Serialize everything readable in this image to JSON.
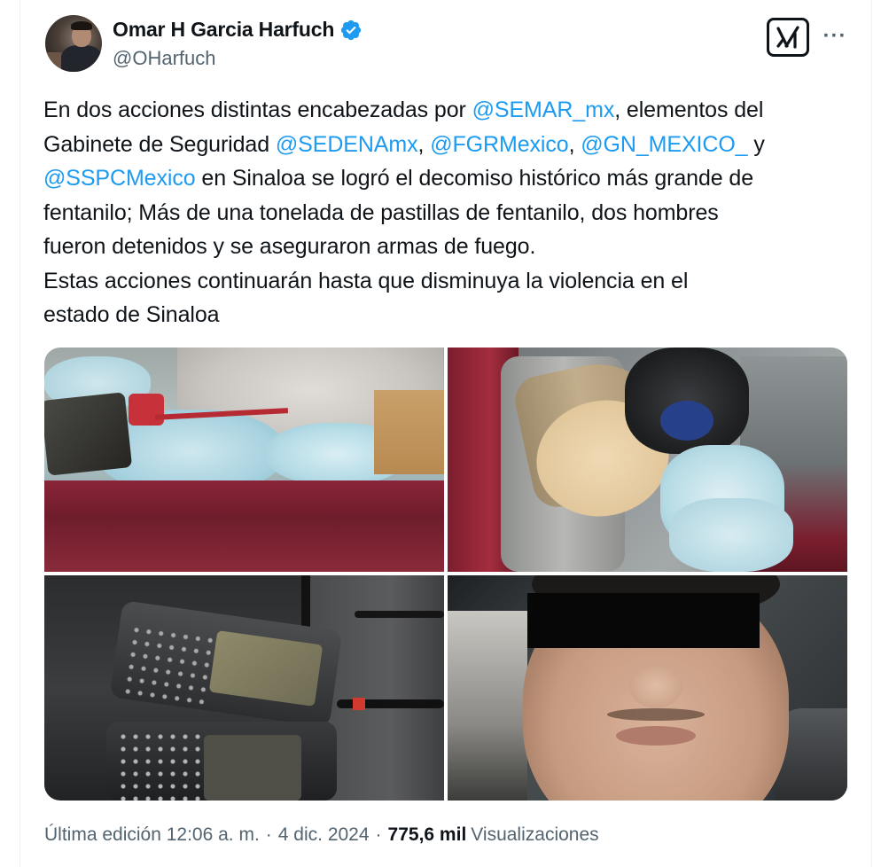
{
  "author": {
    "display_name": "Omar H Garcia Harfuch",
    "handle": "@OHarfuch",
    "verified": true
  },
  "actions": {
    "grok_icon": "grok-icon",
    "more_icon": "more-icon",
    "more_label": "···"
  },
  "tweet": {
    "lines": [
      [
        {
          "text": "En dos acciones distintas encabezadas por ",
          "mention": false
        },
        {
          "text": "@SEMAR_mx",
          "mention": true
        },
        {
          "text": ", elementos del",
          "mention": false
        }
      ],
      [
        {
          "text": "Gabinete de Seguridad ",
          "mention": false
        },
        {
          "text": "@SEDENAmx",
          "mention": true
        },
        {
          "text": ", ",
          "mention": false
        },
        {
          "text": "@FGRMexico",
          "mention": true
        },
        {
          "text": ", ",
          "mention": false
        },
        {
          "text": "@GN_MEXICO_",
          "mention": true
        },
        {
          "text": "  y",
          "mention": false
        }
      ],
      [
        {
          "text": "@SSPCMexico",
          "mention": true
        },
        {
          "text": " en Sinaloa se logró el decomiso histórico más grande de",
          "mention": false
        }
      ],
      [
        {
          "text": "fentanilo; Más de una tonelada de pastillas de fentanilo, dos hombres",
          "mention": false
        }
      ],
      [
        {
          "text": "fueron detenidos y se aseguraron armas de fuego.",
          "mention": false
        }
      ],
      [
        {
          "text": "Estas acciones continuarán hasta que disminuya la violencia en el",
          "mention": false
        }
      ],
      [
        {
          "text": "estado de Sinaloa",
          "mention": false
        }
      ]
    ]
  },
  "media": {
    "photos": [
      {
        "name": "photo-truck-bed"
      },
      {
        "name": "photo-barrel-in-cab"
      },
      {
        "name": "photo-radios"
      },
      {
        "name": "photo-detainee"
      }
    ]
  },
  "footer": {
    "edited": "Última edición 12:06 a. m.",
    "separator": "·",
    "date": "4 dic. 2024",
    "views_count": "775,6 mil",
    "views_label": "Visualizaciones"
  },
  "colors": {
    "text": "#0f1419",
    "secondary": "#536471",
    "mention": "#1d9bf0",
    "verified": "#1d9bf0"
  }
}
